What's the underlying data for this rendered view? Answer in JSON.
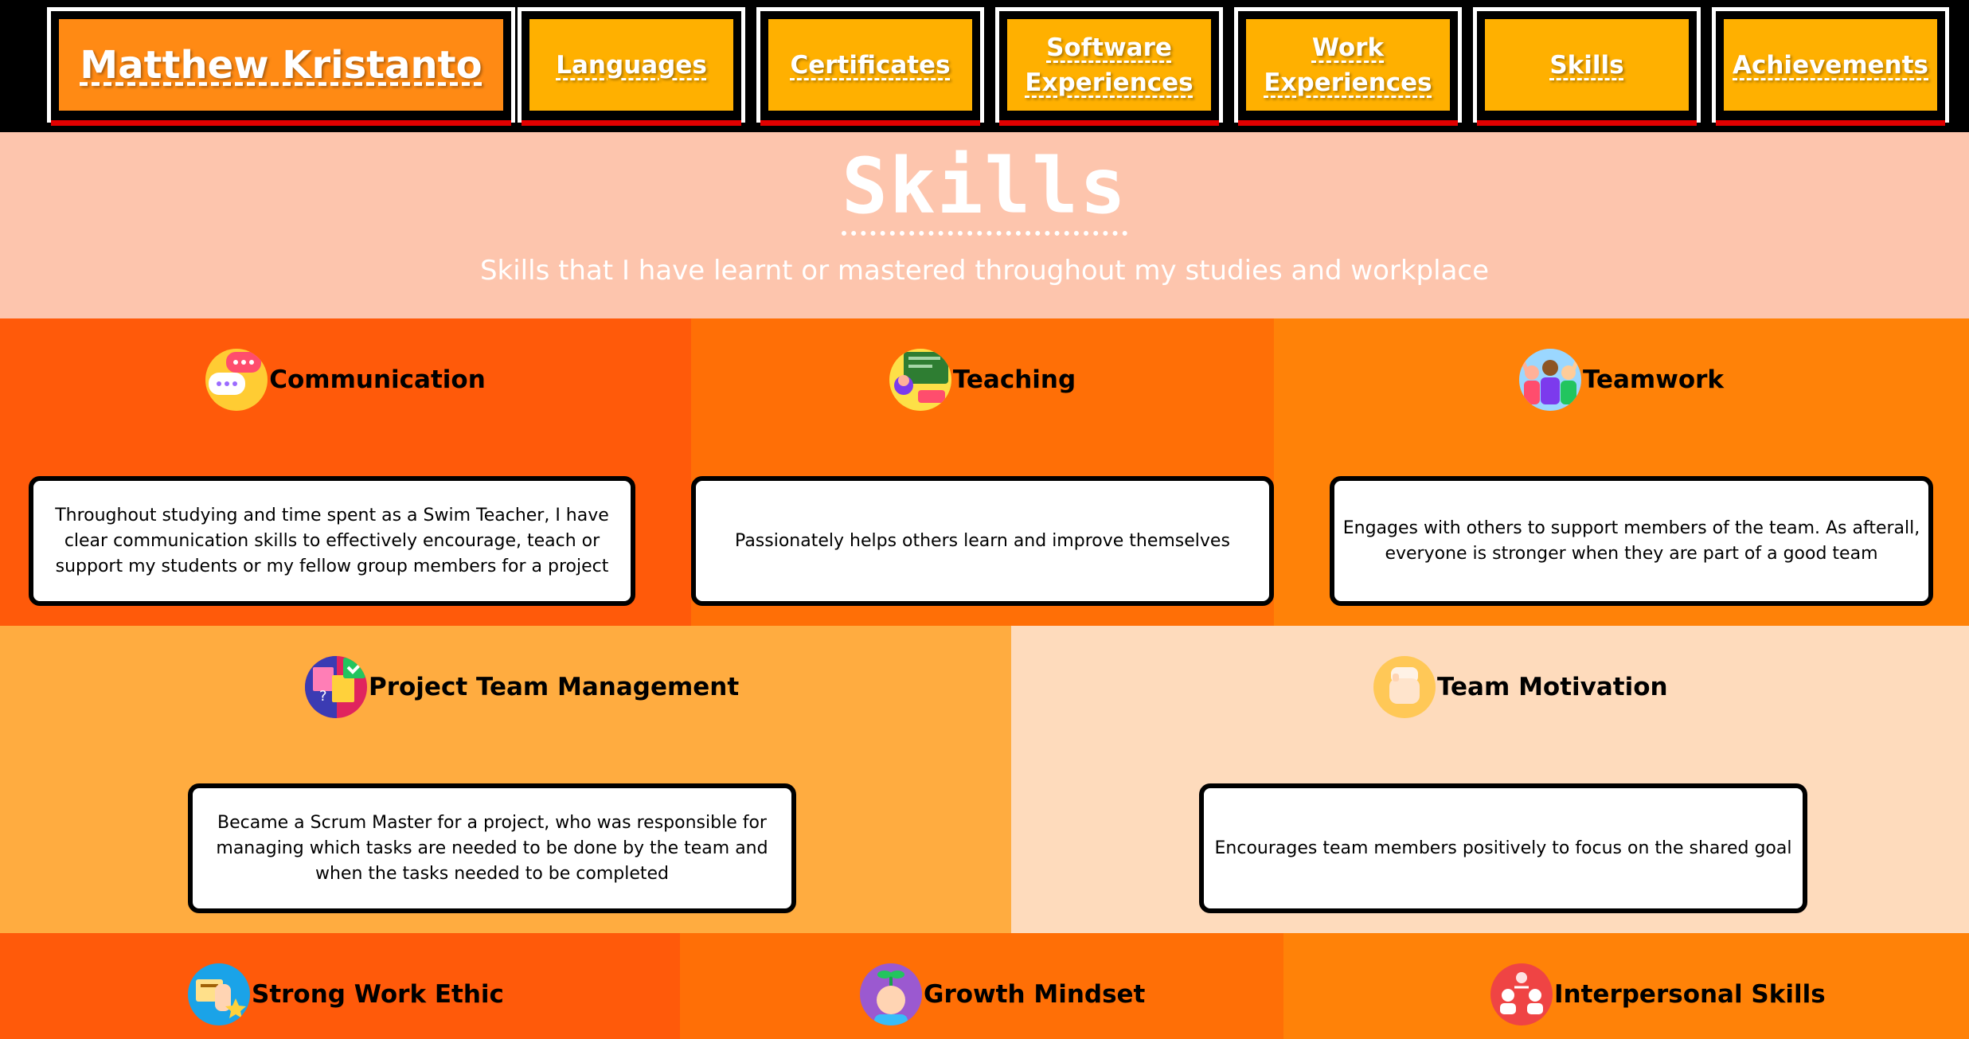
{
  "nav": {
    "brand": "Matthew Kristanto",
    "items": [
      {
        "label": "Languages"
      },
      {
        "label": "Certificates"
      },
      {
        "label": "Software Experiences"
      },
      {
        "label": "Work Experiences"
      },
      {
        "label": "Skills"
      },
      {
        "label": "Achievements"
      }
    ]
  },
  "header": {
    "title": "Skills",
    "subtitle": "Skills that I have learnt or mastered throughout my studies and workplace"
  },
  "skills": [
    {
      "name": "Communication",
      "icon": "chat-bubbles-icon",
      "description": "Throughout studying and time spent as a Swim Teacher, I have clear communication skills to effectively encourage, teach or support my students or my fellow group members for a project",
      "bg": "#ff5a0a"
    },
    {
      "name": "Teaching",
      "icon": "teacher-board-icon",
      "description": "Passionately helps others learn and improve themselves",
      "bg": "#ff6f06"
    },
    {
      "name": "Teamwork",
      "icon": "team-people-icon",
      "description": "Engages with others to support members of the team. As afterall, everyone is stronger when they are part of a good team",
      "bg": "#ff8208"
    },
    {
      "name": "Project Team Management",
      "icon": "project-board-icon",
      "description": "Became a Scrum Master for a project, who was responsible for managing which tasks are needed to be done by the team and when the tasks needed to be completed",
      "bg": "#ffac40"
    },
    {
      "name": "Team Motivation",
      "icon": "fist-icon",
      "description": "Encourages team members positively to focus on the shared goal",
      "bg": "#fedbbc"
    },
    {
      "name": "Strong Work Ethic",
      "icon": "hand-star-icon",
      "description": "",
      "bg": "#ff5a0a"
    },
    {
      "name": "Growth Mindset",
      "icon": "growing-mind-icon",
      "description": "",
      "bg": "#ff6f06"
    },
    {
      "name": "Interpersonal Skills",
      "icon": "people-connect-icon",
      "description": "",
      "bg": "#ff8208"
    }
  ]
}
